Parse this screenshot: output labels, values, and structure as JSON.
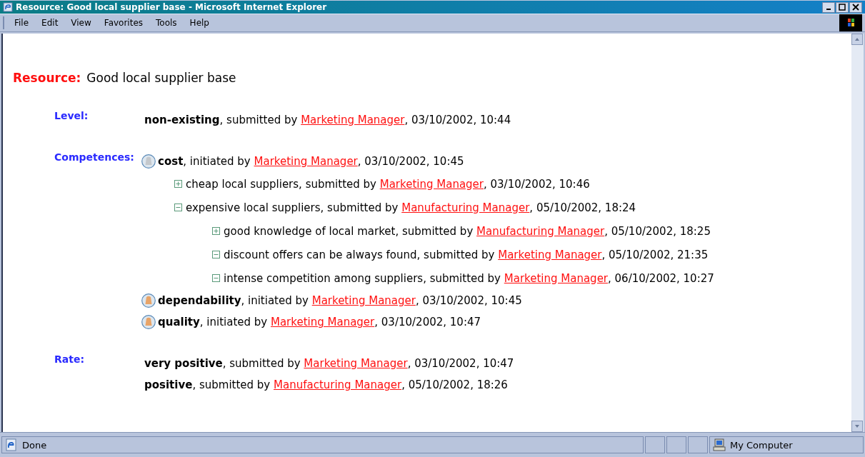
{
  "window": {
    "title": "Resource: Good local supplier base - Microsoft Internet Explorer"
  },
  "menu": [
    "File",
    "Edit",
    "View",
    "Favorites",
    "Tools",
    "Help"
  ],
  "heading": {
    "label": "Resource:",
    "title": "Good local supplier base"
  },
  "sections": [
    {
      "kind": "entries",
      "label": "Level:",
      "entries": [
        {
          "text": "**non-existing**, submitted by",
          "author": "Marketing Manager",
          "tail": ", 03/10/2002, 10:44"
        }
      ]
    },
    {
      "kind": "tree",
      "label": "Competences:",
      "items": [
        {
          "text": "**cost**, initiated by",
          "author": "Marketing Manager",
          "tail": ", 03/10/2002, 10:45",
          "color": "#c4c8cc",
          "children": [
            {
              "text": "cheap local suppliers, submitted by",
              "author": "Marketing Manager",
              "tail": ", 03/10/2002, 10:46",
              "expanded": false
            },
            {
              "text": "expensive local suppliers, submitted by",
              "author": "Manufacturing Manager",
              "tail": ", 05/10/2002, 18:24",
              "expanded": true,
              "children": [
                {
                  "text": "good knowledge of local market, submitted by",
                  "author": "Manufacturing Manager",
                  "tail": ", 05/10/2002, 18:25",
                  "expanded": false
                },
                {
                  "text": "discount offers can be always found, submitted by",
                  "author": "Marketing Manager",
                  "tail": ", 05/10/2002, 21:35",
                  "expanded": true
                },
                {
                  "text": "intense competition among suppliers, submitted by",
                  "author": "Marketing Manager",
                  "tail": ", 06/10/2002, 10:27",
                  "expanded": true
                }
              ]
            }
          ]
        },
        {
          "text": "**dependability**, initiated by",
          "author": "Marketing Manager",
          "tail": ", 03/10/2002, 10:45",
          "color": "#e8a468"
        },
        {
          "text": "**quality**, initiated by",
          "author": "Marketing Manager",
          "tail": ", 03/10/2002, 10:47",
          "color": "#e8a468"
        }
      ]
    },
    {
      "kind": "entries",
      "label": "Rate:",
      "entries": [
        {
          "text": "**very positive**, submitted by",
          "author": "Marketing Manager",
          "tail": ", 03/10/2002, 10:47"
        },
        {
          "text": "**positive**, submitted by",
          "author": "Manufacturing Manager",
          "tail": ", 05/10/2002, 18:26"
        }
      ]
    }
  ],
  "status_bar": {
    "text": "Done",
    "zone": "My Computer"
  }
}
